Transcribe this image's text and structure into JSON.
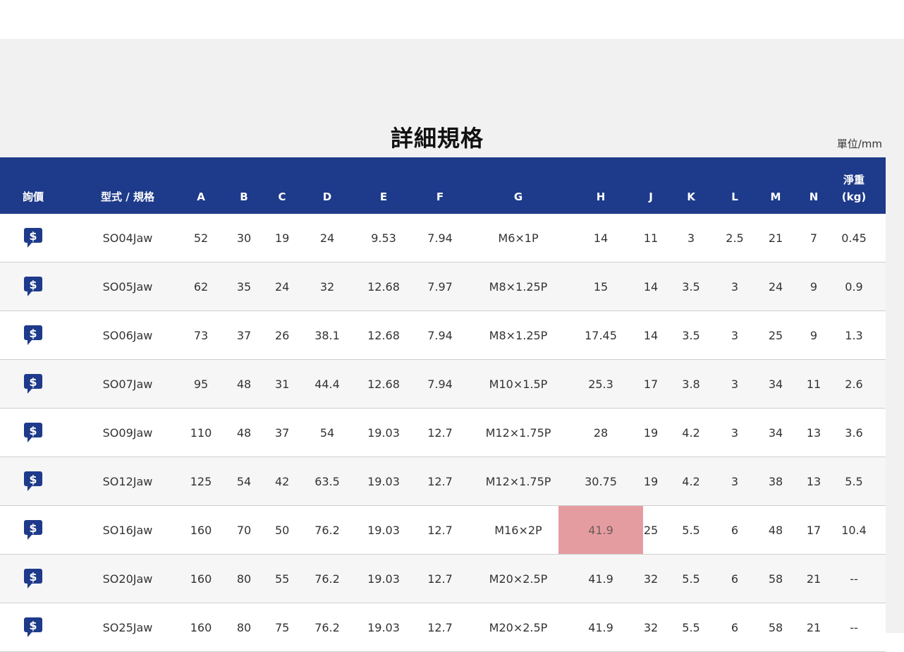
{
  "page": {
    "title": "詳細規格",
    "unit": "單位/mm"
  },
  "colors": {
    "header_bg": "#1e3a8a",
    "highlight": "#e59ca0",
    "page_bg": "#f1f1f1"
  },
  "table": {
    "headers": {
      "quote": "詢價",
      "model": "型式 / 規格",
      "A": "A",
      "B": "B",
      "C": "C",
      "D": "D",
      "E": "E",
      "F": "F",
      "G": "G",
      "H": "H",
      "J": "J",
      "K": "K",
      "L": "L",
      "M": "M",
      "N": "N",
      "weight_line1": "淨重",
      "weight_line2": "(kg)"
    },
    "quote_icon": "dollar-speech-bubble-icon",
    "rows": [
      {
        "model": "SO04Jaw",
        "A": "52",
        "B": "30",
        "C": "19",
        "D": "24",
        "E": "9.53",
        "F": "7.94",
        "G": "M6×1P",
        "H": "14",
        "J": "11",
        "K": "3",
        "L": "2.5",
        "M": "21",
        "N": "7",
        "weight": "0.45"
      },
      {
        "model": "SO05Jaw",
        "A": "62",
        "B": "35",
        "C": "24",
        "D": "32",
        "E": "12.68",
        "F": "7.97",
        "G": "M8×1.25P",
        "H": "15",
        "J": "14",
        "K": "3.5",
        "L": "3",
        "M": "24",
        "N": "9",
        "weight": "0.9"
      },
      {
        "model": "SO06Jaw",
        "A": "73",
        "B": "37",
        "C": "26",
        "D": "38.1",
        "E": "12.68",
        "F": "7.94",
        "G": "M8×1.25P",
        "H": "17.45",
        "J": "14",
        "K": "3.5",
        "L": "3",
        "M": "25",
        "N": "9",
        "weight": "1.3"
      },
      {
        "model": "SO07Jaw",
        "A": "95",
        "B": "48",
        "C": "31",
        "D": "44.4",
        "E": "12.68",
        "F": "7.94",
        "G": "M10×1.5P",
        "H": "25.3",
        "J": "17",
        "K": "3.8",
        "L": "3",
        "M": "34",
        "N": "11",
        "weight": "2.6"
      },
      {
        "model": "SO09Jaw",
        "A": "110",
        "B": "48",
        "C": "37",
        "D": "54",
        "E": "19.03",
        "F": "12.7",
        "G": "M12×1.75P",
        "H": "28",
        "J": "19",
        "K": "4.2",
        "L": "3",
        "M": "34",
        "N": "13",
        "weight": "3.6"
      },
      {
        "model": "SO12Jaw",
        "A": "125",
        "B": "54",
        "C": "42",
        "D": "63.5",
        "E": "19.03",
        "F": "12.7",
        "G": "M12×1.75P",
        "H": "30.75",
        "J": "19",
        "K": "4.2",
        "L": "3",
        "M": "38",
        "N": "13",
        "weight": "5.5"
      },
      {
        "model": "SO16Jaw",
        "A": "160",
        "B": "70",
        "C": "50",
        "D": "76.2",
        "E": "19.03",
        "F": "12.7",
        "G": "M16×2P",
        "H": "41.9",
        "J": "25",
        "K": "5.5",
        "L": "6",
        "M": "48",
        "N": "17",
        "weight": "10.4"
      },
      {
        "model": "SO20Jaw",
        "A": "160",
        "B": "80",
        "C": "55",
        "D": "76.2",
        "E": "19.03",
        "F": "12.7",
        "G": "M20×2.5P",
        "H": "41.9",
        "J": "32",
        "K": "5.5",
        "L": "6",
        "M": "58",
        "N": "21",
        "weight": "--"
      },
      {
        "model": "SO25Jaw",
        "A": "160",
        "B": "80",
        "C": "75",
        "D": "76.2",
        "E": "19.03",
        "F": "12.7",
        "G": "M20×2.5P",
        "H": "41.9",
        "J": "32",
        "K": "5.5",
        "L": "6",
        "M": "58",
        "N": "21",
        "weight": "--"
      }
    ]
  }
}
